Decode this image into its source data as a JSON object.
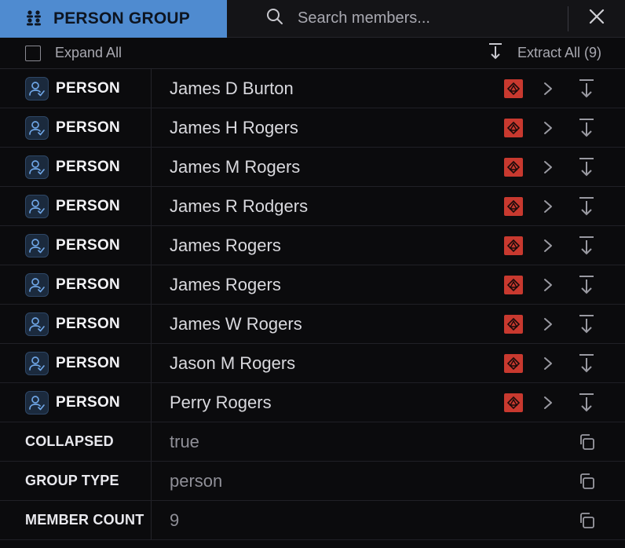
{
  "header": {
    "title": "PERSON GROUP",
    "search_placeholder": "Search members..."
  },
  "toolbar": {
    "expand_label": "Expand All",
    "extract_label": "Extract All (9)"
  },
  "members": [
    {
      "type": "PERSON",
      "name": "James D Burton"
    },
    {
      "type": "PERSON",
      "name": "James H Rogers"
    },
    {
      "type": "PERSON",
      "name": "James M Rogers"
    },
    {
      "type": "PERSON",
      "name": "James R Rodgers"
    },
    {
      "type": "PERSON",
      "name": "James Rogers"
    },
    {
      "type": "PERSON",
      "name": "James Rogers"
    },
    {
      "type": "PERSON",
      "name": "James W Rogers"
    },
    {
      "type": "PERSON",
      "name": "Jason M Rogers"
    },
    {
      "type": "PERSON",
      "name": "Perry Rogers"
    }
  ],
  "properties": [
    {
      "label": "COLLAPSED",
      "value": "true"
    },
    {
      "label": "GROUP TYPE",
      "value": "person"
    },
    {
      "label": "MEMBER COUNT",
      "value": "9"
    }
  ],
  "colors": {
    "accent": "#4f8bd0",
    "warning": "#c8392f",
    "background": "#0b0b0d"
  }
}
